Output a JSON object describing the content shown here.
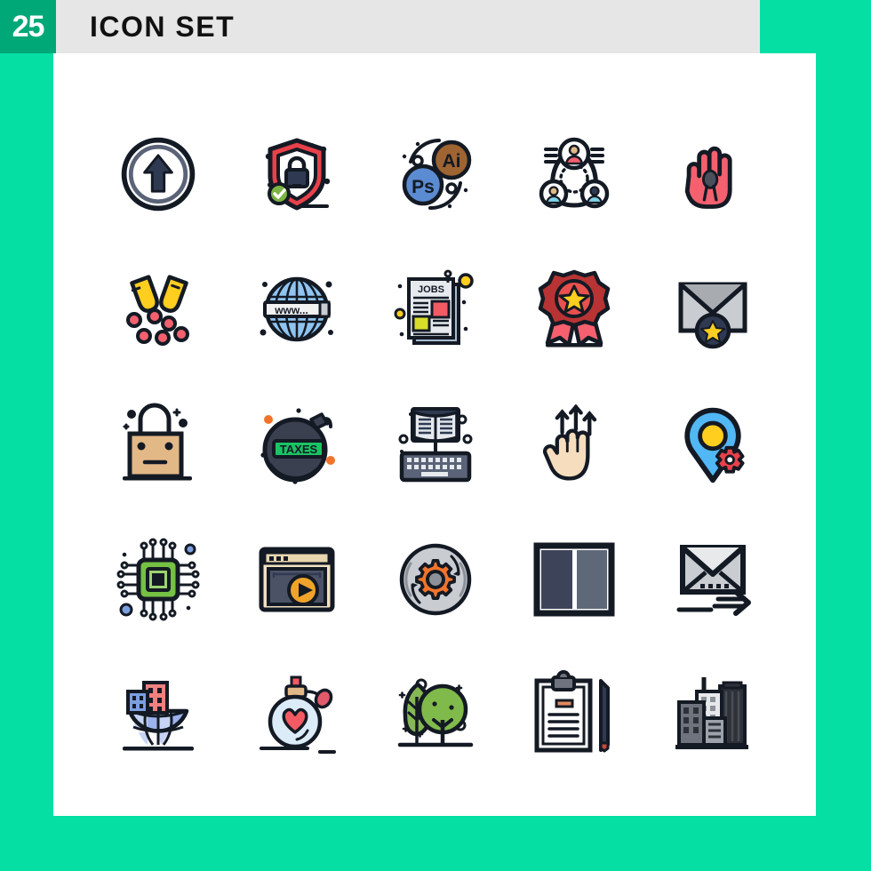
{
  "header": {
    "count_badge": "25",
    "title": "ICON SET"
  },
  "colors": {
    "background": "#05DFA4",
    "badge_green": "#00A878",
    "titlebar_gray": "#E6E6E6",
    "sheet_white": "#FFFFFF",
    "outline_dark": "#141A24",
    "navy": "#2F3A52",
    "red": "#E8414A",
    "pink": "#F4606E",
    "yellow": "#FFCE1F",
    "blue": "#5B8BD0",
    "light_blue": "#8FC4F0",
    "brown": "#9E6432",
    "green": "#6DBE45",
    "orange": "#F2742B",
    "tan": "#E3B887",
    "gray": "#C9CCD1"
  },
  "grid": {
    "rows": 5,
    "columns": 5,
    "total": 25
  },
  "icons": [
    {
      "row": 1,
      "col": 1,
      "name": "upload-arrow-circle-icon",
      "label": "Upload Arrow Circle"
    },
    {
      "row": 1,
      "col": 2,
      "name": "security-shield-lock-icon",
      "label": "Security Shield Lock"
    },
    {
      "row": 1,
      "col": 3,
      "name": "design-tools-ps-ai-icon",
      "label": "Design Tools Ps Ai",
      "text": {
        "primary": "Ps",
        "secondary": "Ai"
      }
    },
    {
      "row": 1,
      "col": 4,
      "name": "team-network-icon",
      "label": "Team Network"
    },
    {
      "row": 1,
      "col": 5,
      "name": "awareness-ribbon-hand-icon",
      "label": "Awareness Ribbon Hand"
    },
    {
      "row": 2,
      "col": 1,
      "name": "capsule-medicine-icon",
      "label": "Open Capsule Medicine"
    },
    {
      "row": 2,
      "col": 2,
      "name": "www-globe-icon",
      "label": "WWW Globe"
    },
    {
      "row": 2,
      "col": 3,
      "name": "jobs-newspaper-icon",
      "label": "Jobs Newspaper",
      "text": {
        "primary": "JOBS"
      }
    },
    {
      "row": 2,
      "col": 4,
      "name": "award-badge-star-icon",
      "label": "Award Badge Star"
    },
    {
      "row": 2,
      "col": 5,
      "name": "favorite-mail-star-icon",
      "label": "Favorite Mail Star"
    },
    {
      "row": 3,
      "col": 1,
      "name": "shopping-bag-icon",
      "label": "Shopping Bag"
    },
    {
      "row": 3,
      "col": 2,
      "name": "taxes-bomb-icon",
      "label": "Taxes Bomb",
      "text": {
        "primary": "TAXES"
      }
    },
    {
      "row": 3,
      "col": 3,
      "name": "online-education-keyboard-icon",
      "label": "Online Education Keyboard"
    },
    {
      "row": 3,
      "col": 4,
      "name": "swipe-up-gesture-icon",
      "label": "Three Finger Swipe Up Gesture"
    },
    {
      "row": 3,
      "col": 5,
      "name": "location-settings-pin-icon",
      "label": "Location Settings Pin"
    },
    {
      "row": 4,
      "col": 1,
      "name": "cpu-chip-icon",
      "label": "CPU Chip"
    },
    {
      "row": 4,
      "col": 2,
      "name": "video-player-browser-icon",
      "label": "Video Player Browser"
    },
    {
      "row": 4,
      "col": 3,
      "name": "processing-gear-icon",
      "label": "Processing Gear"
    },
    {
      "row": 4,
      "col": 4,
      "name": "two-column-layout-icon",
      "label": "Two Column Layout"
    },
    {
      "row": 4,
      "col": 5,
      "name": "send-mail-icon",
      "label": "Send Mail"
    },
    {
      "row": 5,
      "col": 1,
      "name": "global-city-icon",
      "label": "Global City"
    },
    {
      "row": 5,
      "col": 2,
      "name": "perfume-heart-icon",
      "label": "Perfume Heart"
    },
    {
      "row": 5,
      "col": 3,
      "name": "trees-park-icon",
      "label": "Trees Park"
    },
    {
      "row": 5,
      "col": 4,
      "name": "clipboard-pencil-icon",
      "label": "Clipboard Pencil"
    },
    {
      "row": 5,
      "col": 5,
      "name": "city-buildings-icon",
      "label": "City Buildings"
    }
  ]
}
